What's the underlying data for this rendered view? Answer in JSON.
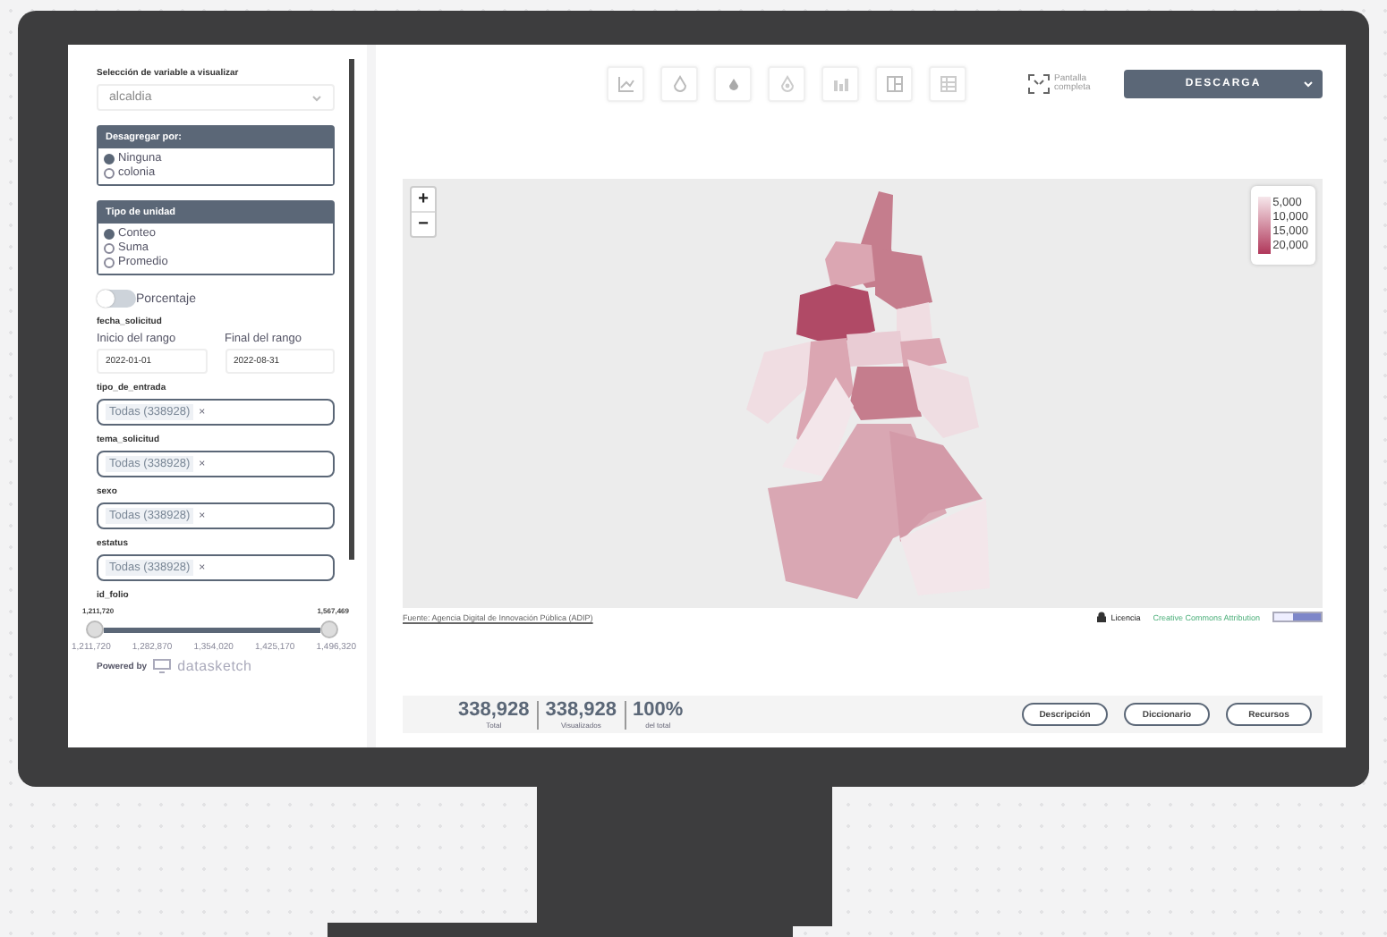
{
  "sidebar": {
    "variable_select": {
      "label": "Selección de variable a visualizar",
      "value": "alcaldia"
    },
    "disaggregate": {
      "title": "Desagregar por:",
      "options": [
        {
          "label": "Ninguna",
          "selected": true
        },
        {
          "label": "colonia",
          "selected": false
        }
      ]
    },
    "unit_type": {
      "title": "Tipo de unidad",
      "options": [
        {
          "label": "Conteo",
          "selected": true
        },
        {
          "label": "Suma",
          "selected": false
        },
        {
          "label": "Promedio",
          "selected": false
        }
      ]
    },
    "percentage_toggle": {
      "label": "Porcentaje",
      "on": false
    },
    "date_range": {
      "label": "fecha_solicitud",
      "start_label": "Inicio del rango",
      "start": "2022-01-01",
      "end_label": "Final del rango",
      "end": "2022-08-31"
    },
    "filters": [
      {
        "label": "tipo_de_entrada",
        "tag": "Todas (338928)",
        "remove": "×"
      },
      {
        "label": "tema_solicitud",
        "tag": "Todas (338928)",
        "remove": "×"
      },
      {
        "label": "sexo",
        "tag": "Todas (338928)",
        "remove": "×"
      },
      {
        "label": "estatus",
        "tag": "Todas (338928)",
        "remove": "×"
      }
    ],
    "folio_slider": {
      "label": "id_folio",
      "min": "1,211,720",
      "max": "1,567,469",
      "level": 1,
      "ticks": [
        "1,211,720",
        "1,282,870",
        "1,354,020",
        "1,425,170",
        "1,496,320"
      ]
    },
    "powered_by": {
      "label": "Powered by",
      "brand": "datasketch"
    }
  },
  "toolbar": {
    "fullscreen": "Pantalla completa",
    "download": "DESCARGA"
  },
  "map": {
    "zoom_in": "+",
    "zoom_out": "−",
    "legend": [
      "5,000",
      "10,000",
      "15,000",
      "20,000"
    ],
    "source": "Fuente: Agencia Digital de Innovación Pública (ADIP)",
    "license": "Licencia",
    "license_name": "Creative Commons Attribution"
  },
  "stats": [
    {
      "value": "338,928",
      "label": "Total"
    },
    {
      "value": "338,928",
      "label": "Visualizados"
    },
    {
      "value": "100%",
      "label": "del total"
    }
  ],
  "buttons": [
    "Descripción",
    "Diccionario",
    "Recursos"
  ]
}
